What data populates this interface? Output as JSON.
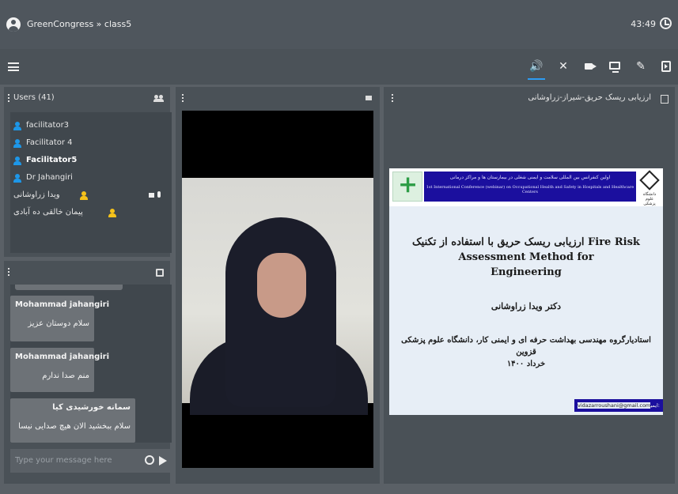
{
  "topbar": {
    "breadcrumb": "GreenCongress » class5",
    "timer": "43:49"
  },
  "toolbar": {
    "icons": [
      "menu-icon",
      "speaker-icon",
      "mic-off-icon",
      "camera-icon",
      "screen-share-icon",
      "pen-icon",
      "exit-icon"
    ],
    "accent": "#2d9cf2"
  },
  "users": {
    "title": "Users (41)",
    "list": [
      {
        "name": "facilitator3"
      },
      {
        "name": "Facilitator 4"
      },
      {
        "name": "Facilitator5"
      },
      {
        "name": "Dr Jahangiri"
      },
      {
        "name": "ویدا زراوشانی"
      },
      {
        "name": "پیمان خالقی ده آبادی"
      }
    ]
  },
  "chat": {
    "messages": [
      {
        "sender": "Mohammad jahangiri",
        "text": "سلام دوستان عزیز"
      },
      {
        "sender": "Mohammad jahangiri",
        "text": "منم صدا ندارم"
      },
      {
        "sender": "سمانه خورشیدی کیا",
        "text": "سلام ببخشید الان هیچ صدایی نیسا"
      }
    ],
    "input_placeholder": "Type your message here"
  },
  "presentation": {
    "header": "ارزیابی ریسک حریق-شیراز-زراوشانی",
    "banner_fa": "اولین کنفرانس بین المللی سلامت و ایمنی شغلی در بیمارستان ها و مراکز درمانی",
    "banner_en": "1st International Conference (webinar) on Occupational Health and Safety in Hospitals and Healthcare Centers",
    "logo_right_text": "دانشگاه علوم پزشکی",
    "title_line1": "ارزیابی ریسک حریق با استفاده از تکنیک Fire Risk Assessment Method for",
    "title_line2": "Engineering",
    "author": "دکتر ویدا زراوشانی",
    "affiliation_line1": "استادیارگروه مهندسی بهداشت حرفه ای و ایمنی کار، دانشگاه علوم پزشکی قزوین",
    "affiliation_line2": "خرداد ۱۴۰۰",
    "email_label": "ایمیل:",
    "email": "vidazarroushani@gmail.com"
  }
}
